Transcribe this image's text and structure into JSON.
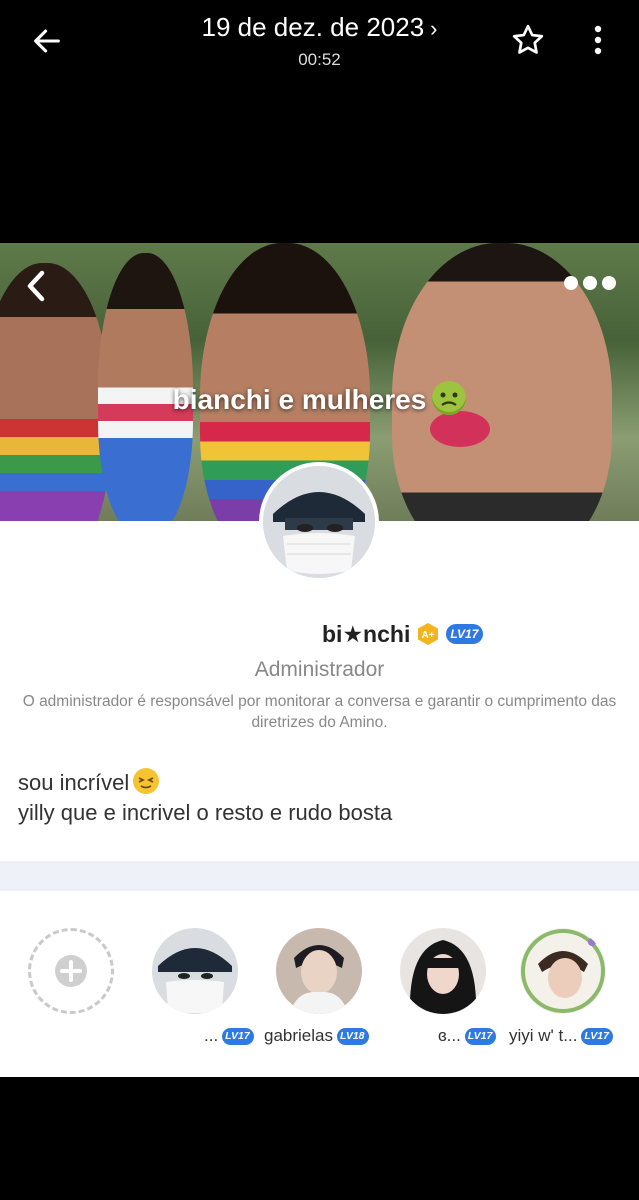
{
  "topbar": {
    "date": "19 de dez. de 2023",
    "chevron": "›",
    "time": "00:52",
    "icons": [
      "back-arrow-icon",
      "star-icon",
      "more-vertical-icon"
    ]
  },
  "banner": {
    "title": "bianchi e mulheres",
    "title_emoji": "nauseated-face-emoji"
  },
  "profile": {
    "username": "bi★nchi",
    "badges": [
      "A+",
      "LV17"
    ],
    "role": "Administrador",
    "role_description": "O administrador é responsável por monitorar a conversa e garantir o cumprimento das diretrizes do Amino.",
    "bio_line1": "sou incrível",
    "bio_line1_emoji": "squinting-face-emoji",
    "bio_line2": "yilly que e incrivel o resto e rudo bosta"
  },
  "members": [
    {
      "name": "...",
      "level": "LV17"
    },
    {
      "name": "gabrielas",
      "level": "LV18"
    },
    {
      "name": "ɞ...",
      "level": "LV17"
    },
    {
      "name": "yiyi w' t...",
      "level": "LV17"
    }
  ],
  "colors": {
    "accent_blue": "#2f7ae0",
    "badge_gold": "#f2b51d",
    "divider": "#eef1f8"
  }
}
